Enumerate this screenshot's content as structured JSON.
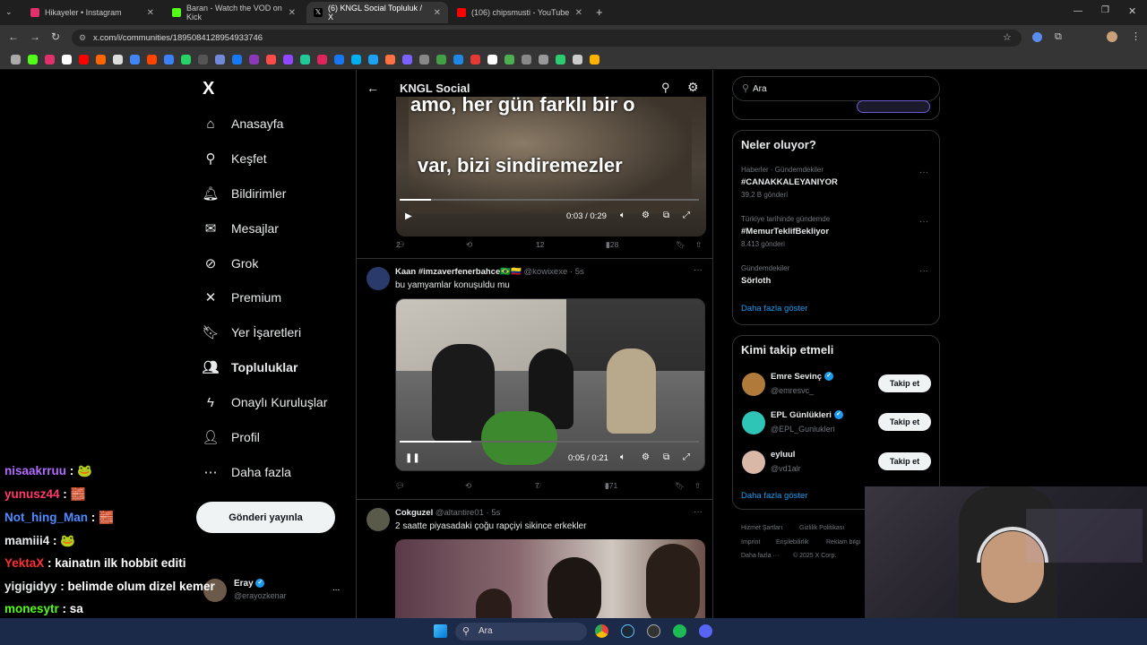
{
  "browser": {
    "tabs": [
      {
        "label": "Hikayeler • Instagram",
        "color": "#e1306c"
      },
      {
        "label": "Baran - Watch the VOD on Kick",
        "color": "#53fc18"
      },
      {
        "label": "(6) KNGL Social Topluluk / X",
        "color": "#ffffff"
      },
      {
        "label": "(106) chipsmusti - YouTube",
        "color": "#ff0000"
      }
    ],
    "new_tab": "+",
    "url": "x.com/i/communities/1895084128954933746"
  },
  "x_nav": {
    "logo": "X",
    "items": [
      {
        "label": "Anasayfa",
        "icon": "home-icon",
        "glyph": "⌂"
      },
      {
        "label": "Keşfet",
        "icon": "search-icon",
        "glyph": "⚲"
      },
      {
        "label": "Bildirimler",
        "icon": "bell-icon",
        "glyph": "🔔︎"
      },
      {
        "label": "Mesajlar",
        "icon": "mail-icon",
        "glyph": "✉"
      },
      {
        "label": "Grok",
        "icon": "grok-icon",
        "glyph": "⊘"
      },
      {
        "label": "Premium",
        "icon": "x-premium-icon",
        "glyph": "✕"
      },
      {
        "label": "Yer İşaretleri",
        "icon": "bookmark-icon",
        "glyph": "🔖︎"
      },
      {
        "label": "Topluluklar",
        "icon": "communities-icon",
        "glyph": "👥︎"
      },
      {
        "label": "Onaylı Kuruluşlar",
        "icon": "lightning-icon",
        "glyph": "ϟ"
      },
      {
        "label": "Profil",
        "icon": "profile-icon",
        "glyph": "👤︎"
      },
      {
        "label": "Daha fazla",
        "icon": "more-circle-icon",
        "glyph": "⋯"
      }
    ],
    "post_button": "Gönderi yayınla",
    "account": {
      "name": "Eray",
      "handle": "@erayozkenar",
      "more": "..."
    }
  },
  "feed": {
    "back": "←",
    "title": "KNGL Social",
    "tweet1": {
      "caption_top": "amo, her gün farklı bir o",
      "caption": "var, bizi sindiremezler",
      "time": "0:03 / 0:29",
      "replies": "2",
      "likes": "12",
      "views": "828"
    },
    "tweet2": {
      "name": "Kaan #imzaverfenerbahce🇧🇷🇨🇴",
      "handle": "@kowixexe · 5s",
      "text": "bu yamyamlar konuşuldu mu",
      "time": "0:05 / 0:21",
      "likes": "7",
      "views": "871"
    },
    "tweet3": {
      "name": "Cokguzel",
      "handle": "@altantire01 · 5s",
      "text": "2 saatte piyasadaki çoğu rapçiyi sikince erkekler"
    }
  },
  "sidebar": {
    "search_placeholder": "Ara",
    "trends_title": "Neler oluyor?",
    "trends": [
      {
        "meta": "Haberler · Gündemdekiler",
        "name": "#CANAKKALEYANIYOR",
        "count": "39,2 B gönderi"
      },
      {
        "meta": "Türkiye tarihinde gündemde",
        "name": "#MemurTeklifBekliyor",
        "count": "8.413 gönderi"
      },
      {
        "meta": "Gündemdekiler",
        "name": "Sörloth",
        "count": ""
      }
    ],
    "trends_more": "Daha fazla göster",
    "follow_title": "Kimi takip etmeli",
    "suggestions": [
      {
        "name": "Emre Sevinç",
        "handle": "@emresvc_",
        "button": "Takip et",
        "verified": true
      },
      {
        "name": "EPL Günlükleri",
        "handle": "@EPL_Gunlukleri",
        "button": "Takip et",
        "verified": true
      },
      {
        "name": "eyluul",
        "handle": "@vd1alr",
        "button": "Takip et",
        "verified": false
      }
    ],
    "follow_more": "Daha fazla göster",
    "footer": [
      "Hizmet Şartları",
      "Gizlilik Politikası",
      "Imprint",
      "Erişilebilirlik",
      "Reklam bilgi",
      "Daha fazla ···",
      "© 2025 X Corp."
    ]
  },
  "stream_chat": [
    {
      "user": "nisaakrruu",
      "msg": " : 🐸",
      "color": "#b36bff"
    },
    {
      "user": "yunusz44",
      "msg": " : 🧱",
      "color": "#ff3b6b"
    },
    {
      "user": "Not_hing_Man",
      "msg": " : 🧱",
      "color": "#4f8cff"
    },
    {
      "user": "mamiii4",
      "msg": " : 🐸",
      "color": "#e7e9ea"
    },
    {
      "user": "YektaX",
      "msg": " : kainatın ilk hobbit editi",
      "color": "#ff3030"
    },
    {
      "user": "yigigidyy",
      "msg": " : belimde olum dizel kemer",
      "color": "#e7e9ea"
    },
    {
      "user": "monesytr",
      "msg": " : sa",
      "color": "#53fc18"
    }
  ],
  "taskbar": {
    "search": "Ara"
  }
}
